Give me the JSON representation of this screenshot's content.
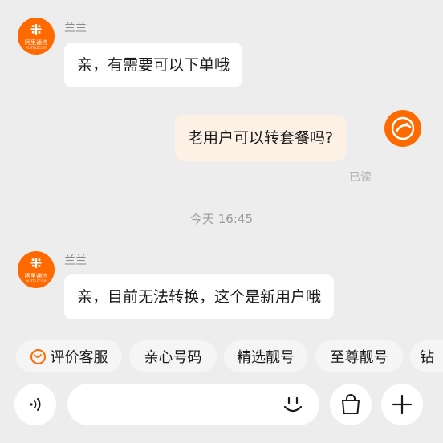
{
  "messages": [
    {
      "sender": "兰兰",
      "avatar_text": "阿里通信",
      "avatar_sub": "ALITELECOM",
      "text": "亲，有需要可以下单哦"
    },
    {
      "text": "老用户可以转套餐吗?",
      "status": "已读"
    },
    {
      "timestamp": "今天 16:45"
    },
    {
      "sender": "兰兰",
      "avatar_text": "阿里通信",
      "avatar_sub": "ALITELECOM",
      "text": "亲，目前无法转换，这个是新用户哦"
    }
  ],
  "quick_replies": [
    "评价客服",
    "亲心号码",
    "精选靓号",
    "至尊靓号",
    "钻"
  ],
  "input": {
    "placeholder": "",
    "voice_icon": "voice-icon",
    "emoji_icon": "emoji-icon",
    "bag_icon": "shopping-bag-icon",
    "plus_icon": "plus-icon"
  },
  "colors": {
    "background": "#ededed",
    "accent": "#ff6a00",
    "my_bubble": "#fdf1e6",
    "other_bubble": "#ffffff"
  }
}
